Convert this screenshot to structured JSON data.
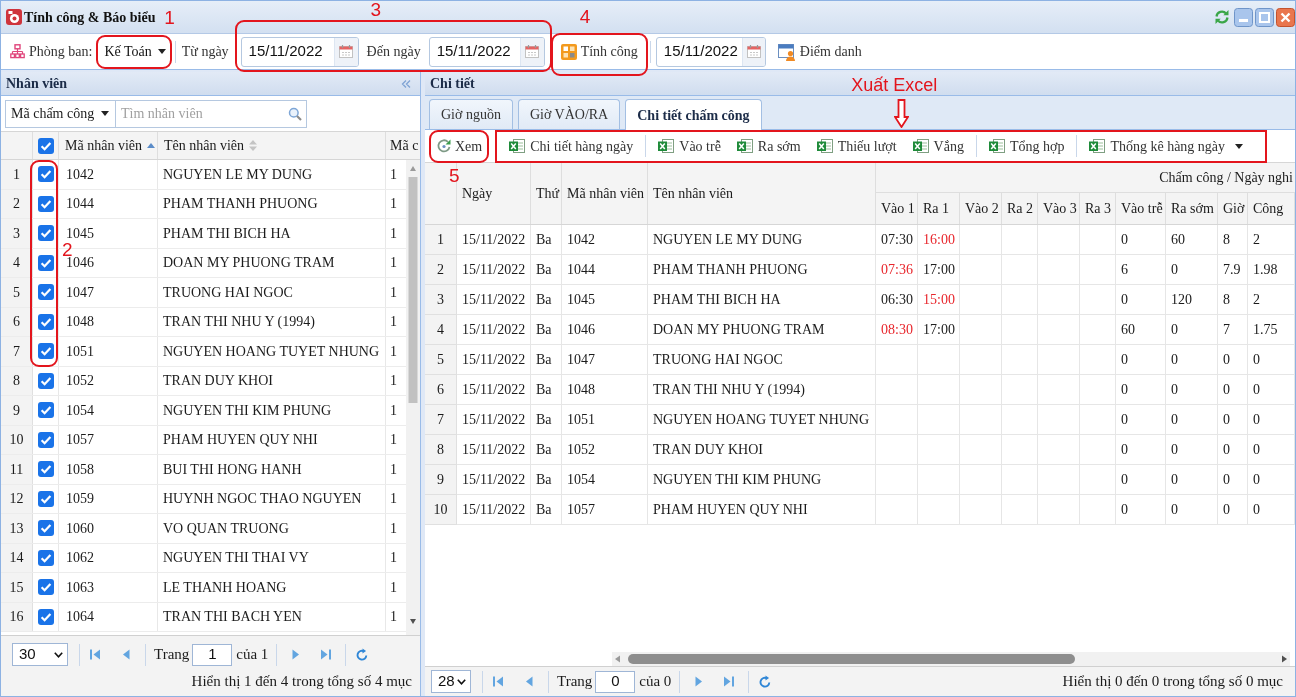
{
  "window": {
    "title": "Tính công & Báo biểu"
  },
  "toolbar": {
    "department": {
      "label": "Phòng ban:",
      "value": "Kế Toán"
    },
    "date_from": {
      "label": "Từ ngày",
      "value": "15/11/2022"
    },
    "date_to": {
      "label": "Đến ngày",
      "value": "15/11/2022"
    },
    "calculate_button": "Tính công",
    "calculate_date": "15/11/2022",
    "attendance_button": "Điểm danh"
  },
  "employees_panel": {
    "title": "Nhân viên",
    "filter": "Mã chấm công",
    "search": {
      "placeholder": "Tìm nhân viên"
    },
    "all_checked": true,
    "columns": [
      {
        "label": "Mã nhân viên",
        "sorted": true
      },
      {
        "label": "Tên nhân viên",
        "sorted": false
      }
    ],
    "column_5": {
      "label": "Mã c"
    },
    "rows": [
      {
        "no": "1",
        "checked": true,
        "code": "1042",
        "name": "NGUYEN LE MY DUNG",
        "column_5": "1"
      },
      {
        "no": "2",
        "checked": true,
        "code": "1044",
        "name": "PHAM THANH PHUONG",
        "column_5": "1"
      },
      {
        "no": "3",
        "checked": true,
        "code": "1045",
        "name": "PHAM THI BICH HA",
        "column_5": "1"
      },
      {
        "no": "4",
        "checked": true,
        "code": "1046",
        "name": "DOAN MY PHUONG TRAM",
        "column_5": "1"
      },
      {
        "no": "5",
        "checked": true,
        "code": "1047",
        "name": "TRUONG HAI NGOC",
        "column_5": "1"
      },
      {
        "no": "6",
        "checked": true,
        "code": "1048",
        "name": "TRAN THI NHU Y (1994)",
        "column_5": "1"
      },
      {
        "no": "7",
        "checked": true,
        "code": "1051",
        "name": "NGUYEN HOANG TUYET NHUNG",
        "column_5": "1"
      },
      {
        "no": "8",
        "checked": true,
        "code": "1052",
        "name": "TRAN DUY KHOI",
        "column_5": "1"
      },
      {
        "no": "9",
        "checked": true,
        "code": "1054",
        "name": "NGUYEN THI KIM PHUNG",
        "column_5": "1"
      },
      {
        "no": "10",
        "checked": true,
        "code": "1057",
        "name": "PHAM HUYEN QUY NHI",
        "column_5": "1"
      },
      {
        "no": "11",
        "checked": true,
        "code": "1058",
        "name": "BUI THI HONG HANH",
        "column_5": "1"
      },
      {
        "no": "12",
        "checked": true,
        "code": "1059",
        "name": "HUYNH NGOC THAO NGUYEN",
        "column_5": "1"
      },
      {
        "no": "13",
        "checked": true,
        "code": "1060",
        "name": "VO QUAN TRUONG",
        "column_5": "1"
      },
      {
        "no": "14",
        "checked": true,
        "code": "1062",
        "name": "NGUYEN THI THAI VY",
        "column_5": "1"
      },
      {
        "no": "15",
        "checked": true,
        "code": "1063",
        "name": "LE THANH HOANG",
        "column_5": "1"
      },
      {
        "no": "16",
        "checked": true,
        "code": "1064",
        "name": "TRAN THI BACH YEN",
        "column_5": "1"
      }
    ],
    "pager": {
      "page_size": "30",
      "page_label": "Trang",
      "page": "1",
      "page_total": "của 1",
      "info": "Hiển thị 1 đến 4 trong tổng số 4 mục"
    }
  },
  "detail_panel": {
    "title": "Chi tiết",
    "tabs": [
      {
        "label": "Giờ nguồn",
        "selected": false
      },
      {
        "label": "Giờ VÀO/RA",
        "selected": false
      },
      {
        "label": "Chi tiết chấm công",
        "selected": true
      }
    ],
    "view_button": "Xem",
    "export_groups": [
      {
        "buttons": [
          {
            "label": "Chi tiết hàng ngày",
            "has_menu": false
          }
        ]
      },
      {
        "buttons": [
          {
            "label": "Vào trễ",
            "has_menu": false
          },
          {
            "label": "Ra sớm",
            "has_menu": false
          },
          {
            "label": "Thiếu lượt",
            "has_menu": false
          },
          {
            "label": "Vắng",
            "has_menu": false
          }
        ]
      },
      {
        "buttons": [
          {
            "label": "Tổng hợp",
            "has_menu": false
          }
        ]
      },
      {
        "buttons": [
          {
            "label": "Thống kê hàng ngày",
            "has_menu": true
          }
        ]
      }
    ],
    "table": {
      "columns": [
        "Ngày",
        "Thứ",
        "Mã nhân viên",
        "Tên nhân viên"
      ],
      "group_header": "Chấm công / Ngày nghi",
      "sub_columns": [
        "Vào 1",
        "Ra 1",
        "Vào 2",
        "Ra 2",
        "Vào 3",
        "Ra 3",
        "Vào trễ",
        "Ra sớm",
        "Giờ",
        "Công"
      ],
      "rows": [
        {
          "no": "1",
          "date": "15/11/2022",
          "weekday": "Ba",
          "code": "1042",
          "name": "NGUYEN LE MY DUNG",
          "punches": [
            {
              "value": "07:30",
              "alert": false
            },
            {
              "value": "16:00",
              "alert": true
            }
          ],
          "late": "0",
          "early": "60",
          "hours": "8",
          "workdays": "2"
        },
        {
          "no": "2",
          "date": "15/11/2022",
          "weekday": "Ba",
          "code": "1044",
          "name": "PHAM THANH PHUONG",
          "punches": [
            {
              "value": "07:36",
              "alert": true
            },
            {
              "value": "17:00",
              "alert": false
            }
          ],
          "late": "6",
          "early": "0",
          "hours": "7.9",
          "workdays": "1.98"
        },
        {
          "no": "3",
          "date": "15/11/2022",
          "weekday": "Ba",
          "code": "1045",
          "name": "PHAM THI BICH HA",
          "punches": [
            {
              "value": "06:30",
              "alert": false
            },
            {
              "value": "15:00",
              "alert": true
            }
          ],
          "late": "0",
          "early": "120",
          "hours": "8",
          "workdays": "2"
        },
        {
          "no": "4",
          "date": "15/11/2022",
          "weekday": "Ba",
          "code": "1046",
          "name": "DOAN MY PHUONG TRAM",
          "punches": [
            {
              "value": "08:30",
              "alert": true
            },
            {
              "value": "17:00",
              "alert": false
            }
          ],
          "late": "60",
          "early": "0",
          "hours": "7",
          "workdays": "1.75"
        },
        {
          "no": "5",
          "date": "15/11/2022",
          "weekday": "Ba",
          "code": "1047",
          "name": "TRUONG HAI NGOC",
          "late": "0",
          "early": "0",
          "hours": "0",
          "workdays": "0"
        },
        {
          "no": "6",
          "date": "15/11/2022",
          "weekday": "Ba",
          "code": "1048",
          "name": "TRAN THI NHU Y (1994)",
          "late": "0",
          "early": "0",
          "hours": "0",
          "workdays": "0"
        },
        {
          "no": "7",
          "date": "15/11/2022",
          "weekday": "Ba",
          "code": "1051",
          "name": "NGUYEN HOANG TUYET NHUNG",
          "late": "0",
          "early": "0",
          "hours": "0",
          "workdays": "0"
        },
        {
          "no": "8",
          "date": "15/11/2022",
          "weekday": "Ba",
          "code": "1052",
          "name": "TRAN DUY KHOI",
          "late": "0",
          "early": "0",
          "hours": "0",
          "workdays": "0"
        },
        {
          "no": "9",
          "date": "15/11/2022",
          "weekday": "Ba",
          "code": "1054",
          "name": "NGUYEN THI KIM PHUNG",
          "late": "0",
          "early": "0",
          "hours": "0",
          "workdays": "0"
        },
        {
          "no": "10",
          "date": "15/11/2022",
          "weekday": "Ba",
          "code": "1057",
          "name": "PHAM HUYEN QUY NHI",
          "late": "0",
          "early": "0",
          "hours": "0",
          "workdays": "0"
        }
      ]
    },
    "pager": {
      "page_size": "28",
      "page_label": "Trang",
      "page": "0",
      "page_total": "của 0",
      "info": "Hiển thị 0 đến 0 trong tổng số 0 mục"
    }
  },
  "annotations": [
    {
      "kind": "marker",
      "label": "1"
    },
    {
      "kind": "marker",
      "label": "2"
    },
    {
      "kind": "marker",
      "label": "3"
    },
    {
      "kind": "marker",
      "label": "4"
    },
    {
      "kind": "marker",
      "label": "5"
    },
    {
      "kind": "callout",
      "label": "Xuất Excel"
    }
  ]
}
